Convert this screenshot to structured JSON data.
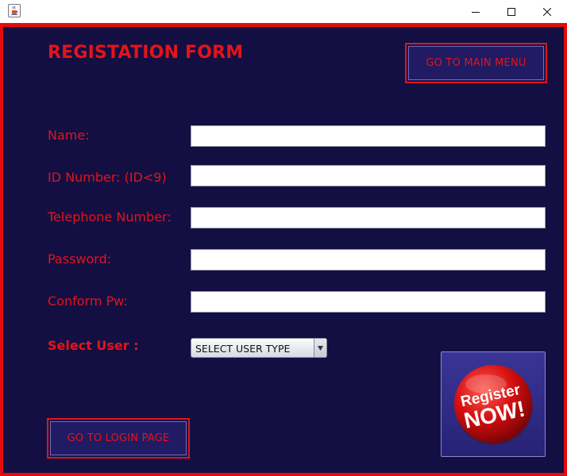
{
  "window": {
    "icon": "java-cup-icon",
    "controls": [
      "minimize-icon",
      "maximize-icon",
      "close-icon"
    ]
  },
  "form": {
    "title": "REGISTATION FORM",
    "main_menu_label": "GO TO MAIN MENU",
    "login_page_label": "GO TO LOGIN PAGE",
    "fields": [
      {
        "label": "Name:",
        "value": ""
      },
      {
        "label": "ID Number: (ID<9)",
        "value": ""
      },
      {
        "label": "Telephone Number:",
        "value": ""
      },
      {
        "label": "Password:",
        "value": ""
      },
      {
        "label": "Conform Pw:",
        "value": ""
      }
    ],
    "select_label": "Select User :",
    "select_value": "SELECT USER TYPE",
    "register_button": {
      "line1": "Register",
      "line2": "NOW!"
    }
  },
  "colors": {
    "background": "#130f43",
    "accent_red": "#e3141a",
    "frame_border": "#e30b0b"
  }
}
